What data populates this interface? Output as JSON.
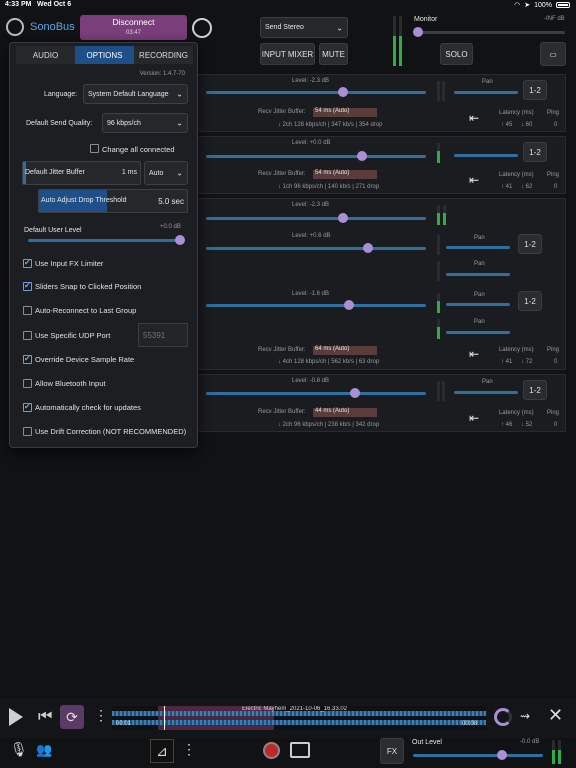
{
  "status_bar": {
    "time": "4:33 PM",
    "date": "Wed Oct 6",
    "battery": "100%"
  },
  "app": {
    "name": "SonoBus"
  },
  "header": {
    "disconnect_label": "Disconnect",
    "session_time": "03:47",
    "send_mode": "Send Stereo",
    "input_mixer": "INPUT MIXER",
    "mute": "MUTE",
    "monitor_label": "Monitor",
    "monitor_level": "-INF dB",
    "solo": "SOLO"
  },
  "settings": {
    "tabs": [
      "AUDIO",
      "OPTIONS",
      "RECORDING"
    ],
    "active_tab": "OPTIONS",
    "version": "Version: 1.4.7-70",
    "language_label": "Language:",
    "language_value": "System Default Language",
    "send_quality_label": "Default Send Quality:",
    "send_quality_value": "96 kbps/ch",
    "change_all_label": "Change all connected",
    "jitter_label": "Default Jitter Buffer",
    "jitter_value": "1 ms",
    "jitter_mode": "Auto",
    "drop_threshold_label": "Auto Adjust Drop Threshold",
    "drop_threshold_value": "5.0 sec",
    "user_level_label": "Default User Level",
    "user_level_value": "+0.0 dB",
    "udp_port_placeholder": "55391",
    "checkboxes": [
      {
        "label": "Use Input FX Limiter",
        "checked": true
      },
      {
        "label": "Sliders Snap to Clicked Position",
        "checked": true
      },
      {
        "label": "Auto-Reconnect to Last Group",
        "checked": false
      },
      {
        "label": "Use Specific UDP Port",
        "checked": false
      },
      {
        "label": "Override Device Sample Rate",
        "checked": true
      },
      {
        "label": "Allow Bluetooth Input",
        "checked": false
      },
      {
        "label": "Automatically check for updates",
        "checked": true
      },
      {
        "label": "Use Drift Correction (NOT RECOMMENDED)",
        "checked": false
      }
    ]
  },
  "peers": [
    {
      "level": "Level: -2.3 dB",
      "pan": "Pan",
      "route": "1-2",
      "jitter_label": "Recv Jitter Buffer:",
      "jitter": "54 ms (Auto)",
      "stats": "↓ 2ch 128 kbps/ch | 347 kb/s | 354 drop",
      "latency_label": "Latency (ms)",
      "ping_label": "Ping",
      "lat_up": "↑ 45",
      "lat_down": "↓ 60",
      "ping": "0"
    },
    {
      "level": "Level: +0.0 dB",
      "pan": "Pan",
      "route": "1-2",
      "jitter_label": "Recv Jitter Buffer:",
      "jitter": "54 ms (Auto)",
      "stats": "↓ 1ch 96 kbps/ch | 140 kb/s | 271 drop",
      "latency_label": "Latency (ms)",
      "ping_label": "Ping",
      "lat_up": "↑ 41",
      "lat_down": "↓ 62",
      "ping": "0"
    },
    {
      "level": "Level: -2.3 dB"
    },
    {
      "level": "Level: +0.6 dB",
      "pan": "Pan",
      "pan2": "Pan",
      "route": "1-2"
    },
    {
      "level": "Level: -1.6 dB",
      "pan": "Pan",
      "pan2": "Pan",
      "route": "1-2",
      "jitter_label": "Recv Jitter Buffer:",
      "jitter": "64 ms (Auto)",
      "stats": "↓ 4ch 128 kbps/ch | 562 kb/s | 63 drop",
      "latency_label": "Latency (ms)",
      "ping_label": "Ping",
      "lat_up": "↑ 41",
      "lat_down": "↓ 72",
      "ping": "0"
    },
    {
      "level": "Level: -0.8 dB",
      "pan": "Pan",
      "route": "1-2",
      "jitter_label": "Recv Jitter Buffer:",
      "jitter": "44 ms (Auto)",
      "stats": "↓ 2ch 96 kbps/ch | 238 kb/s | 342 drop",
      "latency_label": "Latency (ms)",
      "ping_label": "Ping",
      "lat_up": "↑ 46",
      "lat_down": "↓ 52",
      "ping": "0"
    }
  ],
  "transport": {
    "file_name": "Electric Mayhem_2021-10-06_16.33.02",
    "time_start": "00:01",
    "time_end": "00:08",
    "fx_label": "FX",
    "out_level_label": "Out Level",
    "out_level_value": "-0.0 dB"
  },
  "colors": {
    "accent": "#2d6f9e",
    "knob": "#a98fd6",
    "tab_active": "#1e4f88",
    "disconnect": "#7a3e7a",
    "record": "#c0262b"
  }
}
